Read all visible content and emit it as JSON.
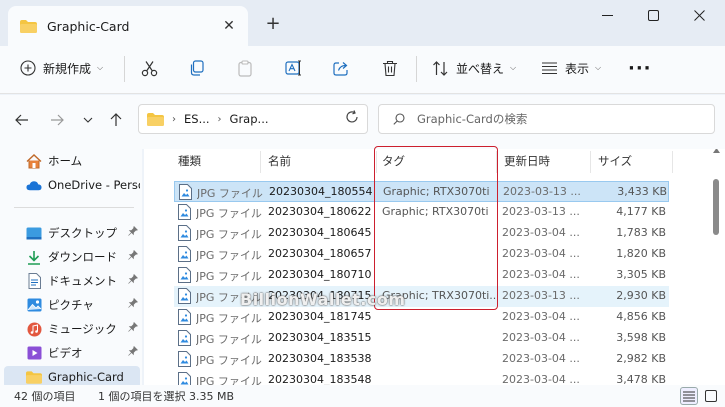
{
  "window": {
    "tab_title": "Graphic-Card",
    "close_glyph": "✕",
    "new_tab_glyph": "+"
  },
  "toolbar": {
    "new_label": "新規作成",
    "sort_label": "並べ替え",
    "view_label": "表示",
    "more_glyph": "···",
    "chevron": "⌵"
  },
  "address": {
    "crumbs": [
      "ES...",
      "Grap..."
    ],
    "crumb_sep": "›",
    "search_placeholder": "Graphic-Cardの検索"
  },
  "sidebar": {
    "items": [
      {
        "label": "ホーム",
        "icon": "home-icon",
        "pinned": false
      },
      {
        "label": "OneDrive - Persona",
        "icon": "onedrive-icon",
        "pinned": false
      },
      {
        "label": "デスクトップ",
        "icon": "desktop-icon",
        "pinned": true
      },
      {
        "label": "ダウンロード",
        "icon": "download-icon",
        "pinned": true
      },
      {
        "label": "ドキュメント",
        "icon": "documents-icon",
        "pinned": true
      },
      {
        "label": "ピクチャ",
        "icon": "pictures-icon",
        "pinned": true
      },
      {
        "label": "ミュージック",
        "icon": "music-icon",
        "pinned": true
      },
      {
        "label": "ビデオ",
        "icon": "videos-icon",
        "pinned": true
      },
      {
        "label": "Graphic-Card",
        "icon": "folder-icon",
        "pinned": false
      }
    ],
    "pin_glyph": "📌"
  },
  "table": {
    "headers": {
      "type": "種類",
      "name": "名前",
      "tag": "タグ",
      "date": "更新日時",
      "size": "サイズ"
    },
    "sort_glyph": "⌃",
    "rows": [
      {
        "type": "JPG ファイル",
        "name": "20230304_180554",
        "tag": "Graphic; RTX3070ti",
        "date": "2023-03-13 ...",
        "size": "3,433 KB",
        "state": "selected"
      },
      {
        "type": "JPG ファイル",
        "name": "20230304_180622",
        "tag": "Graphic; RTX3070ti",
        "date": "2023-03-13 ...",
        "size": "4,177 KB",
        "state": ""
      },
      {
        "type": "JPG ファイル",
        "name": "20230304_180645",
        "tag": "",
        "date": "2023-03-04 ...",
        "size": "1,783 KB",
        "state": ""
      },
      {
        "type": "JPG ファイル",
        "name": "20230304_180657",
        "tag": "",
        "date": "2023-03-04 ...",
        "size": "1,820 KB",
        "state": ""
      },
      {
        "type": "JPG ファイル",
        "name": "20230304_180710",
        "tag": "",
        "date": "2023-03-04 ...",
        "size": "3,305 KB",
        "state": ""
      },
      {
        "type": "JPG ファイル",
        "name": "20230304_180715",
        "tag": "Graphic; TRX3070ti...",
        "date": "2023-03-13 ...",
        "size": "2,930 KB",
        "state": "hover"
      },
      {
        "type": "JPG ファイル",
        "name": "20230304_181745",
        "tag": "",
        "date": "2023-03-04 ...",
        "size": "4,856 KB",
        "state": ""
      },
      {
        "type": "JPG ファイル",
        "name": "20230304_183515",
        "tag": "",
        "date": "2023-03-04 ...",
        "size": "3,598 KB",
        "state": ""
      },
      {
        "type": "JPG ファイル",
        "name": "20230304_183538",
        "tag": "",
        "date": "2023-03-04 ...",
        "size": "2,982 KB",
        "state": ""
      },
      {
        "type": "JPG ファイル",
        "name": "20230304_183548",
        "tag": "",
        "date": "2023-03-04 ...",
        "size": "3,478 KB",
        "state": ""
      }
    ]
  },
  "watermark": "BillionWallet.com",
  "status": {
    "item_count": "42 個の項目",
    "selection": "1 個の項目を選択  3.35 MB"
  },
  "colors": {
    "accent": "#0067c0",
    "selection_bg": "#cce4f7",
    "highlight_border": "#cc1f2e",
    "folder": "#f4c542"
  }
}
